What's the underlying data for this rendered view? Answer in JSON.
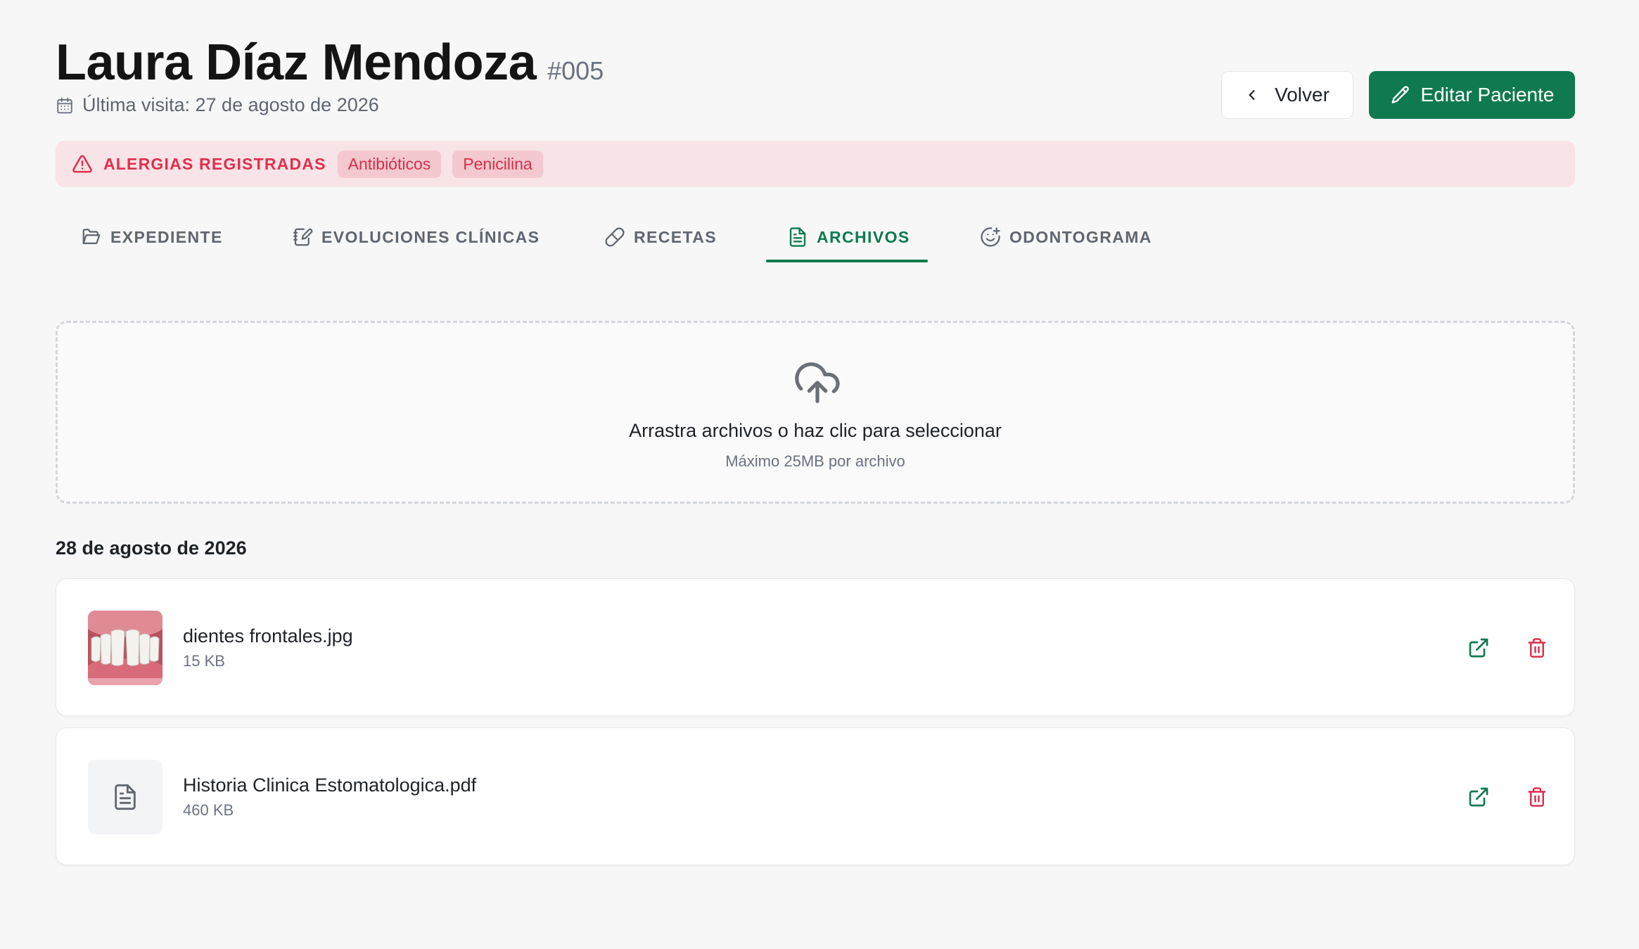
{
  "patient": {
    "name": "Laura Díaz Mendoza",
    "id": "#005",
    "last_visit": "Última visita: 27 de agosto de 2026"
  },
  "header": {
    "back_label": "Volver",
    "edit_label": "Editar Paciente"
  },
  "allergies": {
    "title": "ALERGIAS REGISTRADAS",
    "items": [
      "Antibióticos",
      "Penicilina"
    ]
  },
  "tabs": [
    {
      "label": "EXPEDIENTE",
      "icon": "folder-open-icon",
      "active": false
    },
    {
      "label": "EVOLUCIONES CLÍNICAS",
      "icon": "notebook-pen-icon",
      "active": false
    },
    {
      "label": "RECETAS",
      "icon": "pill-icon",
      "active": false
    },
    {
      "label": "ARCHIVOS",
      "icon": "file-text-icon",
      "active": true
    },
    {
      "label": "ODONTOGRAMA",
      "icon": "smile-plus-icon",
      "active": false
    }
  ],
  "upload": {
    "title": "Arrastra archivos o haz clic para seleccionar",
    "subtitle": "Máximo 25MB por archivo",
    "icon": "cloud-upload-icon"
  },
  "files_group": {
    "date": "28 de agosto de 2026",
    "files": [
      {
        "name": "dientes frontales.jpg",
        "size": "15 KB",
        "kind": "image"
      },
      {
        "name": "Historia Clinica Estomatologica.pdf",
        "size": "460 KB",
        "kind": "document"
      }
    ]
  },
  "colors": {
    "primary": "#0f7a4f",
    "danger": "#df2f4e",
    "allergy_bg": "#f8e3e6",
    "background": "#f7f7f8"
  }
}
